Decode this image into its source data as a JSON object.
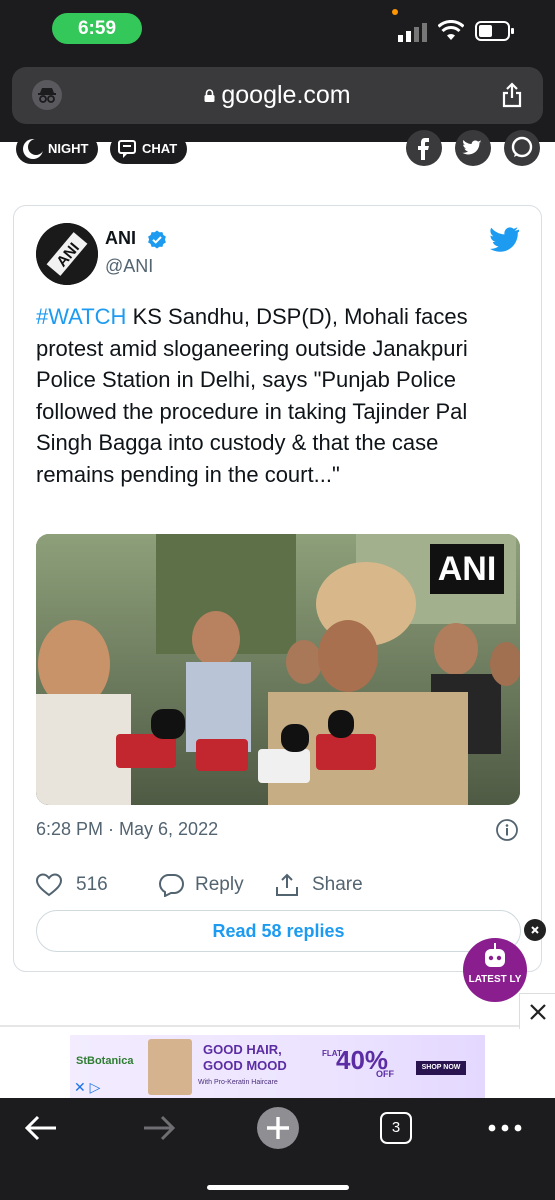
{
  "status_bar": {
    "time": "6:59"
  },
  "address_bar": {
    "url": "google.com"
  },
  "site_header": {
    "night_label": "NIGHT",
    "chat_label": "CHAT"
  },
  "tweet": {
    "author_name": "ANI",
    "author_handle": "@ANI",
    "hashtag": "#WATCH",
    "text": " KS Sandhu, DSP(D), Mohali faces protest amid sloganeering outside Janakpuri Police Station in Delhi, says \"Punjab Police followed the procedure in taking Tajinder Pal Singh Bagga into custody & that the case remains pending in the court...\"",
    "media_watermark": "ANI",
    "timestamp": "6:28 PM · May 6, 2022",
    "likes": "516",
    "reply_label": "Reply",
    "share_label": "Share",
    "read_replies_label": "Read 58 replies"
  },
  "floating_badge": {
    "label": "LATEST LY"
  },
  "ad": {
    "brand": "StBotanica",
    "headline_1": "GOOD HAIR,",
    "headline_2": "GOOD MOOD",
    "subline": "With Pro-Keratin Haircare",
    "flat": "FLAT",
    "discount": "40%",
    "off": "OFF",
    "cta": "SHOP NOW"
  },
  "toolbar": {
    "tab_count": "3"
  },
  "colors": {
    "accent": "#1d9bf0",
    "status_green": "#34c759",
    "chrome": "#1c1c1e"
  }
}
